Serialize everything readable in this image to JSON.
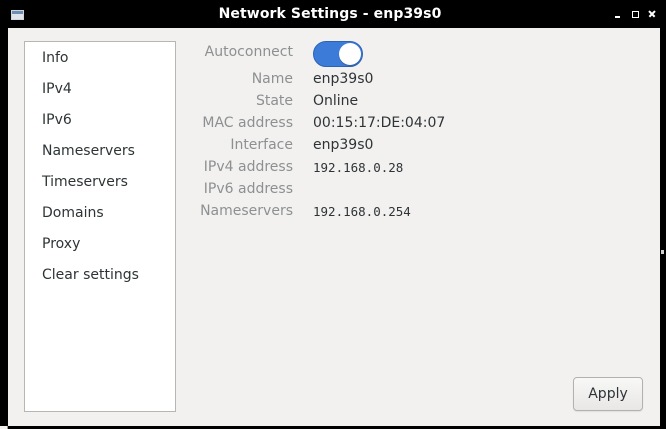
{
  "window": {
    "title": "Network Settings - enp39s0",
    "icon": "window-icon",
    "controls": [
      "minimize-icon",
      "maximize-icon",
      "close-icon"
    ]
  },
  "sidebar": {
    "items": [
      {
        "label": "Info"
      },
      {
        "label": "IPv4"
      },
      {
        "label": "IPv6"
      },
      {
        "label": "Nameservers"
      },
      {
        "label": "Timeservers"
      },
      {
        "label": "Domains"
      },
      {
        "label": "Proxy"
      },
      {
        "label": "Clear settings"
      }
    ]
  },
  "info": {
    "autoconnect": {
      "label": "Autoconnect",
      "enabled": true
    },
    "name": {
      "label": "Name",
      "value": "enp39s0"
    },
    "state": {
      "label": "State",
      "value": "Online"
    },
    "mac": {
      "label": "MAC address",
      "value": "00:15:17:DE:04:07"
    },
    "interface": {
      "label": "Interface",
      "value": "enp39s0"
    },
    "ipv4": {
      "label": "IPv4 address",
      "value": "192.168.0.28"
    },
    "ipv6": {
      "label": "IPv6 address",
      "value": ""
    },
    "nameservers": {
      "label": "Nameservers",
      "value": "192.168.0.254"
    }
  },
  "footer": {
    "apply_label": "Apply"
  },
  "background": {
    "partial_char": "e"
  },
  "colors": {
    "toggle_on": "#3d7bd8",
    "titlebar": "#000000",
    "client_bg": "#f2f1f0",
    "label_gray": "#8d9091"
  }
}
